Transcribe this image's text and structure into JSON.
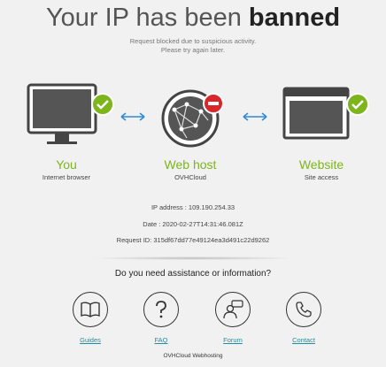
{
  "page": {
    "title_prefix": "Your IP has been ",
    "title_strong": "banned",
    "sub_line1": "Request blocked due to suspicious activity.",
    "sub_line2": "Please try again later."
  },
  "nodes": {
    "you": {
      "label": "You",
      "caption": "Internet browser"
    },
    "host": {
      "label": "Web host",
      "caption": "OVHCloud"
    },
    "website": {
      "label": "Website",
      "caption": "Site access"
    }
  },
  "info": {
    "ip": "IP address : 109.190.254.33",
    "date": "Date : 2020-02-27T14:31:46.081Z",
    "request": "Request ID: 315df67dd77e49124ea3d491c22d9262"
  },
  "help": {
    "question": "Do you need assistance or information?",
    "items": [
      {
        "label": "Guides",
        "icon": "book-icon"
      },
      {
        "label": "FAQ",
        "icon": "question-icon"
      },
      {
        "label": "Forum",
        "icon": "forum-user-icon"
      },
      {
        "label": "Contact",
        "icon": "phone-icon"
      }
    ]
  },
  "footer": {
    "text": "OVHCloud Webhosting"
  },
  "colors": {
    "accent_green": "#7cb51c",
    "ban_red": "#d9262a",
    "link": "#2a8a9a",
    "arrow_blue": "#2f8bd6"
  }
}
